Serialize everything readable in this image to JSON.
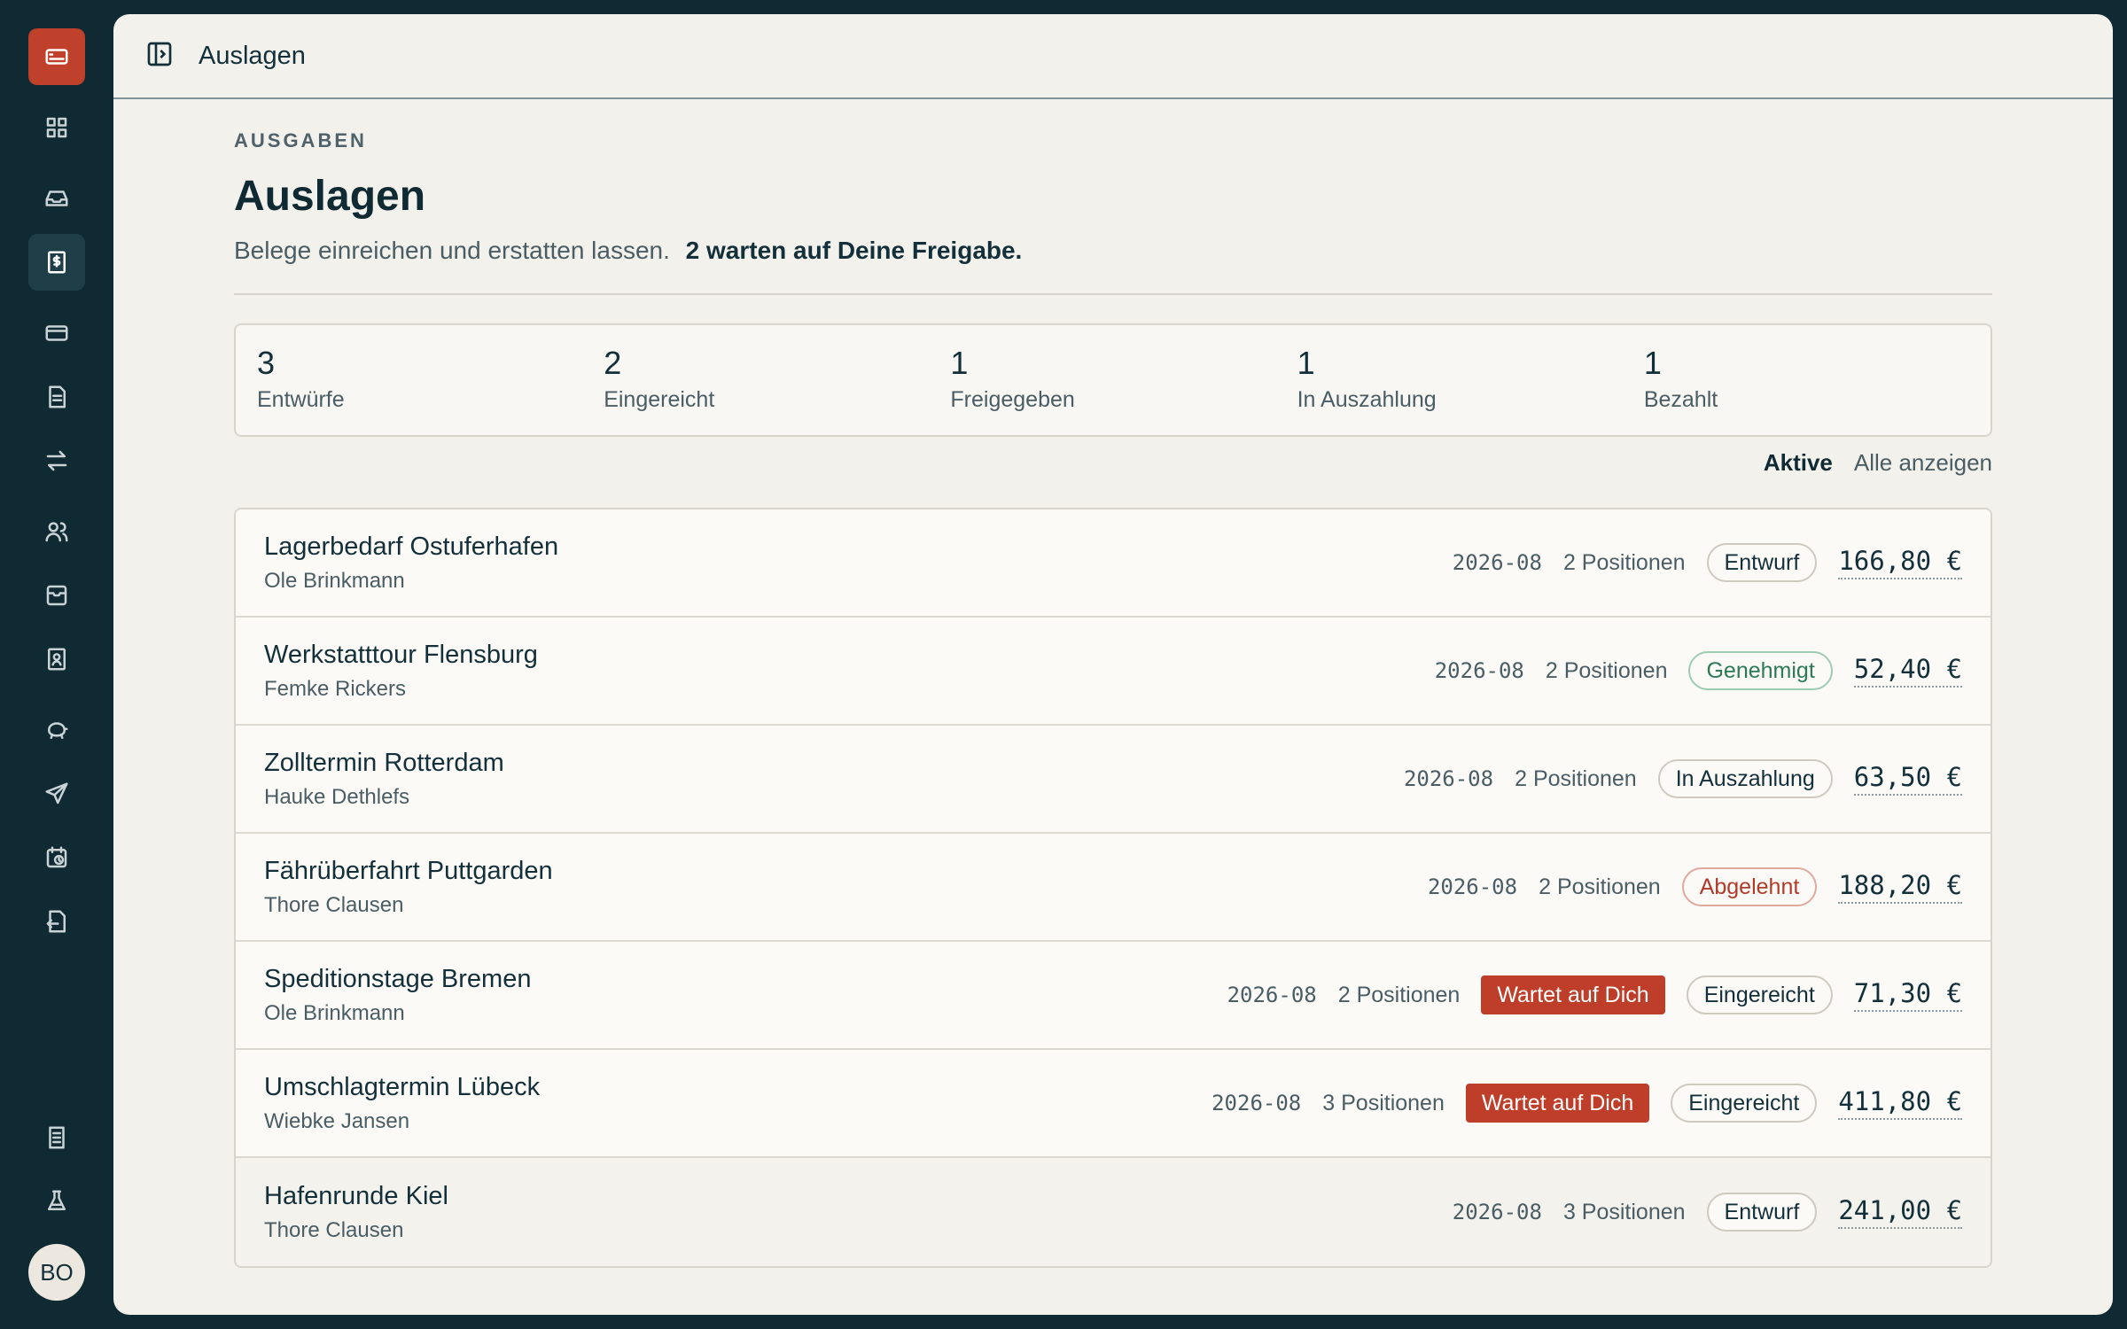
{
  "sidebar": {
    "items": [
      {
        "icon": "card-logo-icon"
      },
      {
        "icon": "grid-icon"
      },
      {
        "icon": "inbox-icon"
      },
      {
        "icon": "receipt-dollar-icon"
      },
      {
        "icon": "credit-card-icon"
      },
      {
        "icon": "document-icon"
      },
      {
        "icon": "transfer-icon"
      },
      {
        "icon": "users-icon"
      },
      {
        "icon": "archive-icon"
      },
      {
        "icon": "contact-book-icon"
      },
      {
        "icon": "piggy-bank-icon"
      },
      {
        "icon": "send-icon"
      },
      {
        "icon": "calendar-clock-icon"
      },
      {
        "icon": "file-export-icon"
      },
      {
        "icon": "building-icon"
      },
      {
        "icon": "flask-icon"
      }
    ],
    "avatar": "BO"
  },
  "topbar": {
    "title": "Auslagen"
  },
  "page": {
    "eyebrow": "AUSGABEN",
    "title": "Auslagen",
    "subtitle": "Belege einreichen und erstatten lassen.",
    "subtitle_strong": "2 warten auf Deine Freigabe."
  },
  "stats": [
    {
      "value": "3",
      "label": "Entwürfe"
    },
    {
      "value": "2",
      "label": "Eingereicht"
    },
    {
      "value": "1",
      "label": "Freigegeben"
    },
    {
      "value": "1",
      "label": "In Auszahlung"
    },
    {
      "value": "1",
      "label": "Bezahlt"
    }
  ],
  "filters": {
    "active": "Aktive",
    "all": "Alle anzeigen"
  },
  "expenses": [
    {
      "title": "Lagerbedarf Ostuferhafen",
      "person": "Ole Brinkmann",
      "date": "2026-08",
      "positions": "2 Positionen",
      "wait": "",
      "status": "Entwurf",
      "amount": "166,80 €"
    },
    {
      "title": "Werkstatttour Flensburg",
      "person": "Femke Rickers",
      "date": "2026-08",
      "positions": "2 Positionen",
      "wait": "",
      "status": "Genehmigt",
      "amount": "52,40 €"
    },
    {
      "title": "Zolltermin Rotterdam",
      "person": "Hauke Dethlefs",
      "date": "2026-08",
      "positions": "2 Positionen",
      "wait": "",
      "status": "In Auszahlung",
      "amount": "63,50 €"
    },
    {
      "title": "Fährüberfahrt Puttgarden",
      "person": "Thore Clausen",
      "date": "2026-08",
      "positions": "2 Positionen",
      "wait": "",
      "status": "Abgelehnt",
      "amount": "188,20 €"
    },
    {
      "title": "Speditionstage Bremen",
      "person": "Ole Brinkmann",
      "date": "2026-08",
      "positions": "2 Positionen",
      "wait": "Wartet auf Dich",
      "status": "Eingereicht",
      "amount": "71,30 €"
    },
    {
      "title": "Umschlagtermin Lübeck",
      "person": "Wiebke Jansen",
      "date": "2026-08",
      "positions": "3 Positionen",
      "wait": "Wartet auf Dich",
      "status": "Eingereicht",
      "amount": "411,80 €"
    },
    {
      "title": "Hafenrunde Kiel",
      "person": "Thore Clausen",
      "date": "2026-08",
      "positions": "3 Positionen",
      "wait": "",
      "status": "Entwurf",
      "amount": "241,00 €"
    }
  ],
  "colors": {
    "accent": "#c0412b",
    "sidebar": "#0f2a33",
    "approved": "#2c7a55",
    "rejected": "#b13a28"
  }
}
